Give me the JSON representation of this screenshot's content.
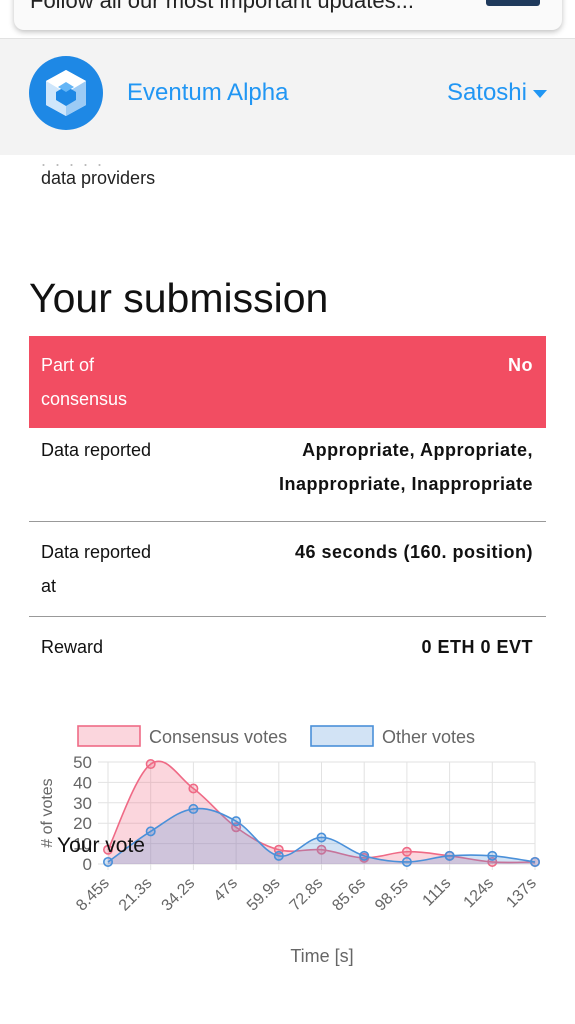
{
  "notification": {
    "text": "Follow all our most important updates..."
  },
  "header": {
    "app_title": "Eventum Alpha",
    "user_name": "Satoshi"
  },
  "content": {
    "cutoff_text": ". . . . .",
    "scroll_text": "data providers",
    "section_title": "Your submission"
  },
  "submission": {
    "consensus": {
      "label": "Part of consensus",
      "value": "No"
    },
    "rows": [
      {
        "label": "Data reported",
        "value_line1": "Appropriate, Appropriate,",
        "value_line2": "Inappropriate, Inappropriate"
      },
      {
        "label": "Data reported at",
        "value_line1": "46 seconds (160. position)"
      },
      {
        "label": "Reward",
        "value_line1": "0 ETH 0 EVT"
      }
    ]
  },
  "colors": {
    "accent": "#2196f3",
    "consensus_red": "#f24d62",
    "series_red": "#ef6a86",
    "series_blue": "#4a90d9"
  },
  "chart_data": {
    "type": "area",
    "xlabel": "Time [s]",
    "ylabel": "# of votes",
    "categories": [
      "8.45s",
      "21.3s",
      "34.2s",
      "47s",
      "59.9s",
      "72.8s",
      "85.6s",
      "98.5s",
      "111s",
      "124s",
      "137s"
    ],
    "ylim": [
      0,
      50
    ],
    "yticks": [
      0,
      10,
      20,
      30,
      40,
      50
    ],
    "legend_position": "top",
    "series": [
      {
        "name": "Consensus votes",
        "values": [
          7,
          49,
          37,
          18,
          7,
          7,
          3,
          6,
          4,
          1,
          1
        ]
      },
      {
        "name": "Other votes",
        "values": [
          1,
          16,
          27,
          21,
          4,
          13,
          4,
          1,
          4,
          4,
          1
        ]
      }
    ],
    "annotation": {
      "text": "Your vote",
      "x": "8.45s"
    }
  }
}
